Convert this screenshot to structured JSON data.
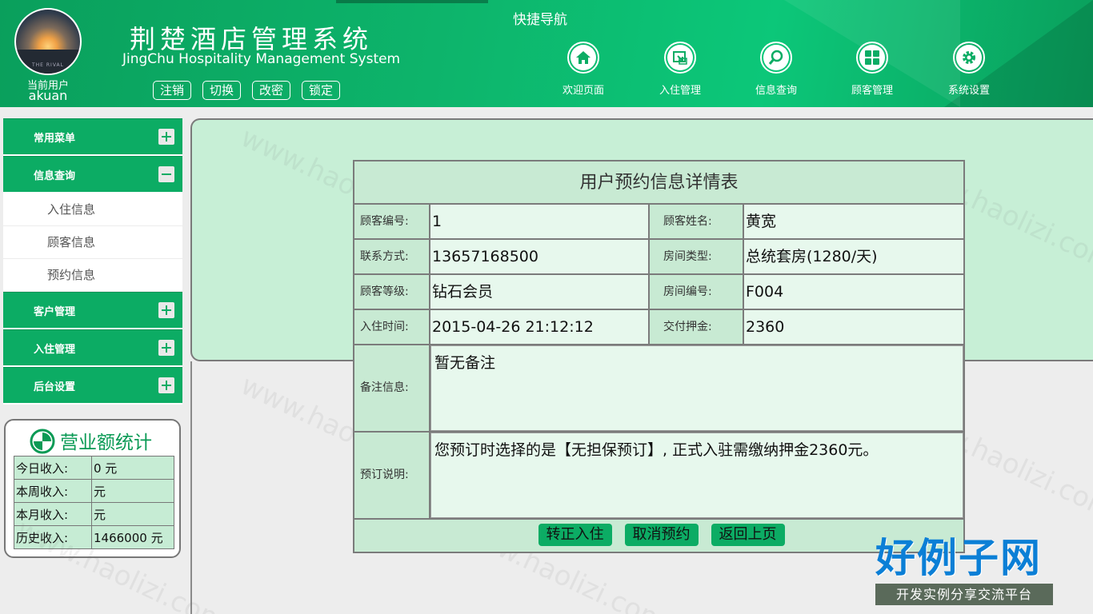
{
  "header": {
    "current_user_label": "当前用户",
    "current_user": "akuan",
    "title_cn": "荆楚酒店管理系统",
    "title_en": "JingChu Hospitality Management System",
    "avatar_caption": "THE RIVAL",
    "buttons": [
      "注销",
      "切换",
      "改密",
      "锁定"
    ],
    "quick_nav_title": "快捷导航",
    "nav": [
      {
        "label": "欢迎页面",
        "icon": "home-icon"
      },
      {
        "label": "入住管理",
        "icon": "checkin-icon"
      },
      {
        "label": "信息查询",
        "icon": "search-icon"
      },
      {
        "label": "顾客管理",
        "icon": "grid-icon"
      },
      {
        "label": "系统设置",
        "icon": "gear-icon"
      }
    ]
  },
  "sidebar": {
    "groups": [
      {
        "label": "常用菜单",
        "expanded": false
      },
      {
        "label": "信息查询",
        "expanded": true,
        "items": [
          "入住信息",
          "顾客信息",
          "预约信息"
        ]
      },
      {
        "label": "客户管理",
        "expanded": false
      },
      {
        "label": "入住管理",
        "expanded": false
      },
      {
        "label": "后台设置",
        "expanded": false
      }
    ]
  },
  "stats": {
    "title": "营业额统计",
    "rows": [
      {
        "key": "今日收入:",
        "value": "0 元"
      },
      {
        "key": "本周收入:",
        "value": "元"
      },
      {
        "key": "本月收入:",
        "value": "元"
      },
      {
        "key": "历史收入:",
        "value": "1466000 元"
      }
    ]
  },
  "detail": {
    "title": "用户预约信息详情表",
    "customer_id_label": "顾客编号:",
    "customer_id": "1",
    "customer_name_label": "顾客姓名:",
    "customer_name": "黄宽",
    "contact_label": "联系方式:",
    "contact": "13657168500",
    "room_type_label": "房间类型:",
    "room_type": "总统套房(1280/天)",
    "level_label": "顾客等级:",
    "level": "钻石会员",
    "room_no_label": "房间编号:",
    "room_no": "F004",
    "checkin_label": "入住时间:",
    "checkin": "2015-04-26 21:12:12",
    "deposit_label": "交付押金:",
    "deposit": "2360",
    "remark_label": "备注信息:",
    "remark": "暂无备注",
    "booking_label": "预订说明:",
    "booking_note": "您预订时选择的是【无担保预订】, 正式入驻需缴纳押金2360元。",
    "buttons": [
      "转正入住",
      "取消预约",
      "返回上页"
    ]
  },
  "watermark": {
    "logo_big": "好例子网",
    "logo_small": "开发实例分享交流平台",
    "text": "www.haolizi.com"
  },
  "colors": {
    "brand_green": "#0cac64",
    "panel_green": "#c7efd6",
    "logo_blue": "#0b7fd6"
  }
}
